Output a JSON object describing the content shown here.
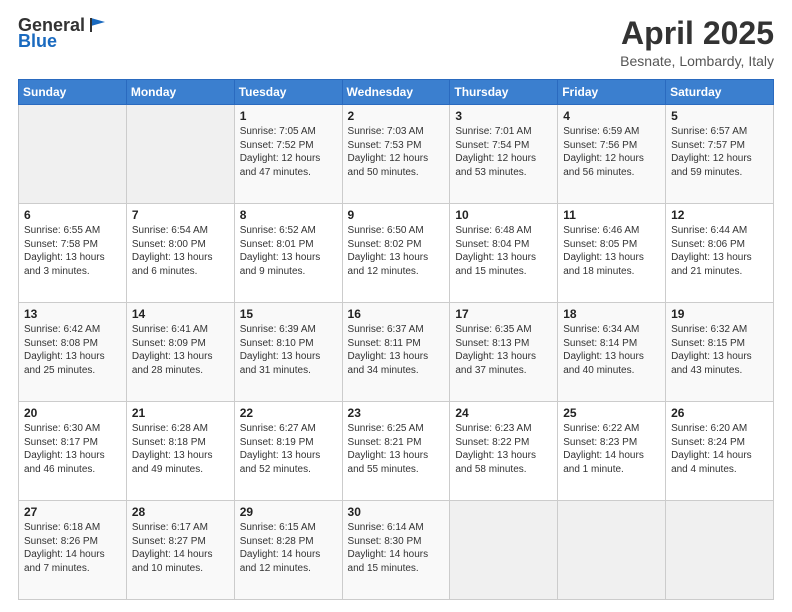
{
  "header": {
    "logo_general": "General",
    "logo_blue": "Blue",
    "month_title": "April 2025",
    "location": "Besnate, Lombardy, Italy"
  },
  "weekdays": [
    "Sunday",
    "Monday",
    "Tuesday",
    "Wednesday",
    "Thursday",
    "Friday",
    "Saturday"
  ],
  "weeks": [
    [
      {
        "day": "",
        "info": ""
      },
      {
        "day": "",
        "info": ""
      },
      {
        "day": "1",
        "info": "Sunrise: 7:05 AM\nSunset: 7:52 PM\nDaylight: 12 hours and 47 minutes."
      },
      {
        "day": "2",
        "info": "Sunrise: 7:03 AM\nSunset: 7:53 PM\nDaylight: 12 hours and 50 minutes."
      },
      {
        "day": "3",
        "info": "Sunrise: 7:01 AM\nSunset: 7:54 PM\nDaylight: 12 hours and 53 minutes."
      },
      {
        "day": "4",
        "info": "Sunrise: 6:59 AM\nSunset: 7:56 PM\nDaylight: 12 hours and 56 minutes."
      },
      {
        "day": "5",
        "info": "Sunrise: 6:57 AM\nSunset: 7:57 PM\nDaylight: 12 hours and 59 minutes."
      }
    ],
    [
      {
        "day": "6",
        "info": "Sunrise: 6:55 AM\nSunset: 7:58 PM\nDaylight: 13 hours and 3 minutes."
      },
      {
        "day": "7",
        "info": "Sunrise: 6:54 AM\nSunset: 8:00 PM\nDaylight: 13 hours and 6 minutes."
      },
      {
        "day": "8",
        "info": "Sunrise: 6:52 AM\nSunset: 8:01 PM\nDaylight: 13 hours and 9 minutes."
      },
      {
        "day": "9",
        "info": "Sunrise: 6:50 AM\nSunset: 8:02 PM\nDaylight: 13 hours and 12 minutes."
      },
      {
        "day": "10",
        "info": "Sunrise: 6:48 AM\nSunset: 8:04 PM\nDaylight: 13 hours and 15 minutes."
      },
      {
        "day": "11",
        "info": "Sunrise: 6:46 AM\nSunset: 8:05 PM\nDaylight: 13 hours and 18 minutes."
      },
      {
        "day": "12",
        "info": "Sunrise: 6:44 AM\nSunset: 8:06 PM\nDaylight: 13 hours and 21 minutes."
      }
    ],
    [
      {
        "day": "13",
        "info": "Sunrise: 6:42 AM\nSunset: 8:08 PM\nDaylight: 13 hours and 25 minutes."
      },
      {
        "day": "14",
        "info": "Sunrise: 6:41 AM\nSunset: 8:09 PM\nDaylight: 13 hours and 28 minutes."
      },
      {
        "day": "15",
        "info": "Sunrise: 6:39 AM\nSunset: 8:10 PM\nDaylight: 13 hours and 31 minutes."
      },
      {
        "day": "16",
        "info": "Sunrise: 6:37 AM\nSunset: 8:11 PM\nDaylight: 13 hours and 34 minutes."
      },
      {
        "day": "17",
        "info": "Sunrise: 6:35 AM\nSunset: 8:13 PM\nDaylight: 13 hours and 37 minutes."
      },
      {
        "day": "18",
        "info": "Sunrise: 6:34 AM\nSunset: 8:14 PM\nDaylight: 13 hours and 40 minutes."
      },
      {
        "day": "19",
        "info": "Sunrise: 6:32 AM\nSunset: 8:15 PM\nDaylight: 13 hours and 43 minutes."
      }
    ],
    [
      {
        "day": "20",
        "info": "Sunrise: 6:30 AM\nSunset: 8:17 PM\nDaylight: 13 hours and 46 minutes."
      },
      {
        "day": "21",
        "info": "Sunrise: 6:28 AM\nSunset: 8:18 PM\nDaylight: 13 hours and 49 minutes."
      },
      {
        "day": "22",
        "info": "Sunrise: 6:27 AM\nSunset: 8:19 PM\nDaylight: 13 hours and 52 minutes."
      },
      {
        "day": "23",
        "info": "Sunrise: 6:25 AM\nSunset: 8:21 PM\nDaylight: 13 hours and 55 minutes."
      },
      {
        "day": "24",
        "info": "Sunrise: 6:23 AM\nSunset: 8:22 PM\nDaylight: 13 hours and 58 minutes."
      },
      {
        "day": "25",
        "info": "Sunrise: 6:22 AM\nSunset: 8:23 PM\nDaylight: 14 hours and 1 minute."
      },
      {
        "day": "26",
        "info": "Sunrise: 6:20 AM\nSunset: 8:24 PM\nDaylight: 14 hours and 4 minutes."
      }
    ],
    [
      {
        "day": "27",
        "info": "Sunrise: 6:18 AM\nSunset: 8:26 PM\nDaylight: 14 hours and 7 minutes."
      },
      {
        "day": "28",
        "info": "Sunrise: 6:17 AM\nSunset: 8:27 PM\nDaylight: 14 hours and 10 minutes."
      },
      {
        "day": "29",
        "info": "Sunrise: 6:15 AM\nSunset: 8:28 PM\nDaylight: 14 hours and 12 minutes."
      },
      {
        "day": "30",
        "info": "Sunrise: 6:14 AM\nSunset: 8:30 PM\nDaylight: 14 hours and 15 minutes."
      },
      {
        "day": "",
        "info": ""
      },
      {
        "day": "",
        "info": ""
      },
      {
        "day": "",
        "info": ""
      }
    ]
  ]
}
